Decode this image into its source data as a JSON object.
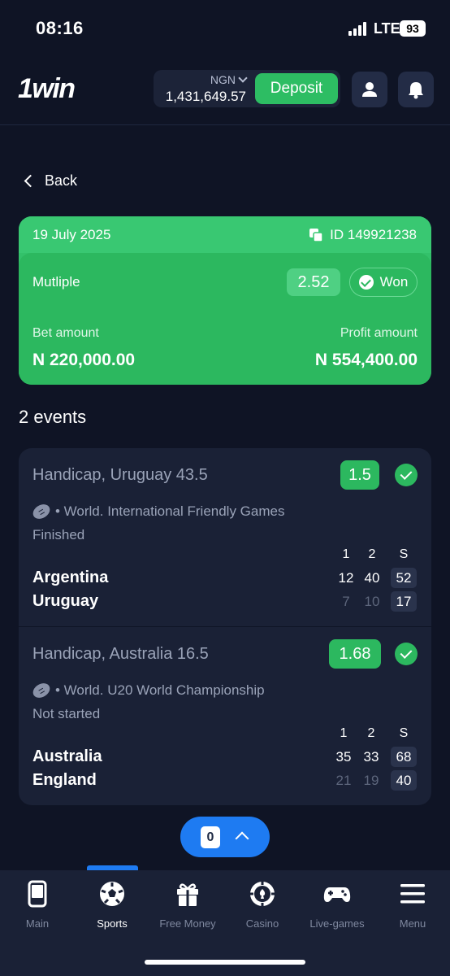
{
  "status_bar": {
    "time": "08:16",
    "network": "LTE",
    "battery": "93"
  },
  "header": {
    "logo": "1win",
    "currency": "NGN",
    "balance": "1,431,649.57",
    "deposit_label": "Deposit",
    "user_icon": "user-icon",
    "bell_icon": "bell-icon"
  },
  "back_label": "Back",
  "bet": {
    "date": "19 July 2025",
    "id": "ID 149921238",
    "type": "Mutliple",
    "coefficient": "2.52",
    "status": "Won",
    "bet_amount_label": "Bet amount",
    "bet_amount": "N 220,000.00",
    "profit_label": "Profit amount",
    "profit_amount": "N 554,400.00",
    "color": "#2cb85f"
  },
  "events_title": "2 events",
  "events": [
    {
      "market": "Handicap, Uruguay 43.5",
      "odds": "1.5",
      "league": "• World. International Friendly Games",
      "status": "Finished",
      "columns": [
        "1",
        "2",
        "S"
      ],
      "teams": [
        {
          "name": "Argentina",
          "scores": [
            "12",
            "40",
            "52"
          ]
        },
        {
          "name": "Uruguay",
          "scores": [
            "7",
            "10",
            "17"
          ]
        }
      ]
    },
    {
      "market": "Handicap, Australia 16.5",
      "odds": "1.68",
      "league": "• World. U20 World Championship",
      "status": "Not started",
      "columns": [
        "1",
        "2",
        "S"
      ],
      "teams": [
        {
          "name": "Australia",
          "scores": [
            "35",
            "33",
            "68"
          ]
        },
        {
          "name": "England",
          "scores": [
            "21",
            "19",
            "40"
          ]
        }
      ]
    }
  ],
  "betslip_count": "0",
  "nav": [
    {
      "label": "Main",
      "icon": "phone-icon"
    },
    {
      "label": "Sports",
      "icon": "soccer-ball-icon",
      "active": true
    },
    {
      "label": "Free Money",
      "icon": "gift-icon"
    },
    {
      "label": "Casino",
      "icon": "poker-chip-icon"
    },
    {
      "label": "Live-games",
      "icon": "gamepad-icon"
    },
    {
      "label": "Menu",
      "icon": "hamburger-icon"
    }
  ]
}
